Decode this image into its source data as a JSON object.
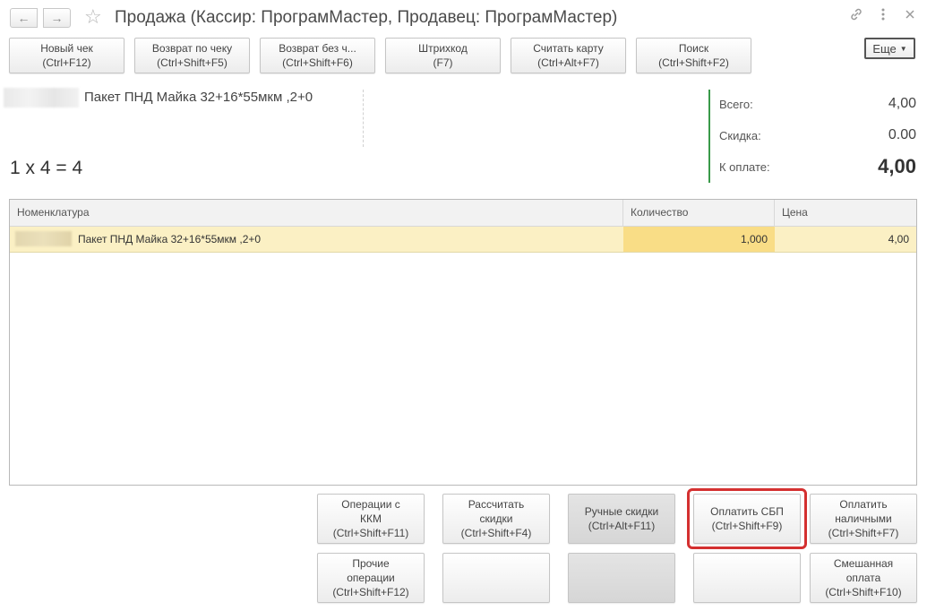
{
  "window": {
    "title": "Продажа (Кассир: ПрограмМастер, Продавец: ПрограмМастер)",
    "back_icon": "arrow-left-icon",
    "forward_icon": "arrow-right-icon",
    "favorite_icon": "star-icon",
    "link_icon": "link-icon",
    "menu_icon": "vertical-dots-icon",
    "close_icon": "close-icon"
  },
  "toolbar": {
    "buttons": [
      {
        "line1": "Новый чек",
        "line2": "(Ctrl+F12)"
      },
      {
        "line1": "Возврат по чеку",
        "line2": "(Ctrl+Shift+F5)"
      },
      {
        "line1": "Возврат без ч...",
        "line2": "(Ctrl+Shift+F6)"
      },
      {
        "line1": "Штрихкод",
        "line2": "(F7)"
      },
      {
        "line1": "Считать карту",
        "line2": "(Ctrl+Alt+F7)"
      },
      {
        "line1": "Поиск",
        "line2": "(Ctrl+Shift+F2)"
      }
    ],
    "more_label": "Еще",
    "more_icon": "dropdown-arrow-icon"
  },
  "current_item": {
    "name": "Пакет ПНД Майка 32+16*55мкм ,2+0",
    "formula": "1 x 4 = 4"
  },
  "summary": {
    "total_label": "Всего:",
    "total_value": "4,00",
    "discount_label": "Скидка:",
    "discount_value": "0.00",
    "to_pay_label": "К оплате:",
    "to_pay_value": "4,00",
    "accent_color": "#3a9a4a"
  },
  "table": {
    "columns": [
      "Номенклатура",
      "Количество",
      "Цена"
    ],
    "rows": [
      {
        "name": "Пакет ПНД Майка 32+16*55мкм ,2+0",
        "quantity": "1,000",
        "price": "4,00"
      }
    ]
  },
  "actions": {
    "row1": [
      {
        "line1": "Операции с",
        "line2": "ККМ",
        "line3": "(Ctrl+Shift+F11)"
      },
      {
        "line1": "Рассчитать",
        "line2": "скидки",
        "line3": "(Ctrl+Shift+F4)"
      },
      {
        "line1": "Ручные скидки",
        "line2": "(Ctrl+Alt+F11)"
      },
      {
        "line1": "Оплатить СБП",
        "line2": "(Ctrl+Shift+F9)"
      },
      {
        "line1": "Оплатить",
        "line2": "наличными",
        "line3": "(Ctrl+Shift+F7)"
      }
    ],
    "row2": [
      {
        "line1": "Прочие",
        "line2": "операции",
        "line3": "(Ctrl+Shift+F12)"
      },
      {
        "line1": ""
      },
      {
        "line1": ""
      },
      {
        "line1": ""
      },
      {
        "line1": "Смешанная",
        "line2": "оплата",
        "line3": "(Ctrl+Shift+F10)"
      }
    ],
    "highlight_color": "#d43030"
  }
}
